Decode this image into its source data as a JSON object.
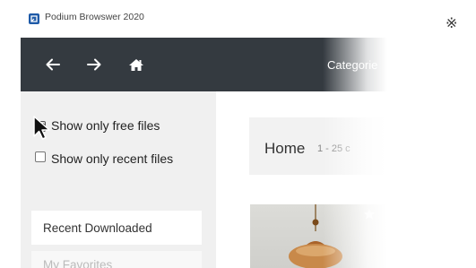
{
  "window": {
    "title": "Podium Browswer 2020"
  },
  "navbar": {
    "category_label": "Categorie"
  },
  "sidebar": {
    "show_free_label": "Show only free files",
    "show_free_checked": true,
    "show_recent_label": "Show only recent files",
    "show_recent_checked": false,
    "recent_downloaded_label": "Recent Downloaded",
    "next_label": "My Favorites"
  },
  "main": {
    "home_title": "Home",
    "results_count": "1 - 25 c"
  },
  "annotation": {
    "reference_mark": "※"
  },
  "colors": {
    "navbar_bg": "#343a40",
    "sidebar_bg": "#f0f0f0"
  }
}
